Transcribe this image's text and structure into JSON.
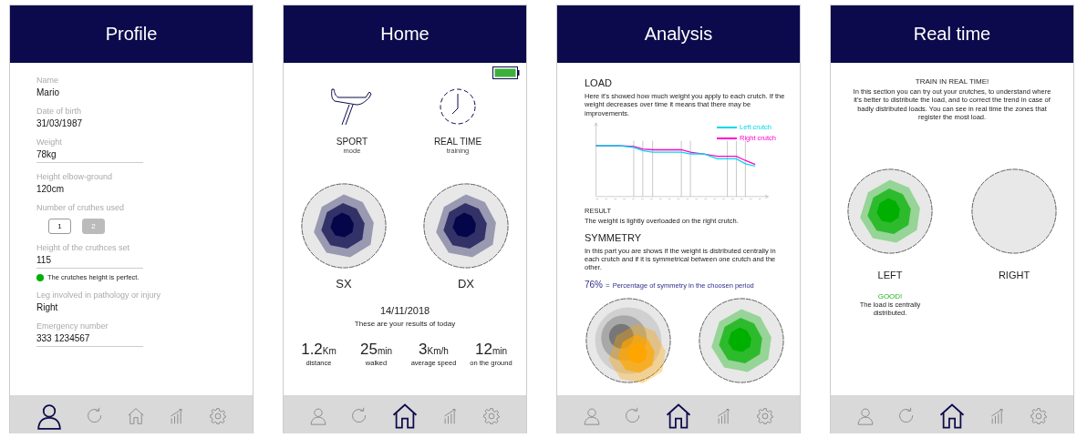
{
  "screens": [
    {
      "kind": "profile",
      "title": "Profile",
      "fields": [
        {
          "kind": "text",
          "label": "Name",
          "value": "Mario"
        },
        {
          "kind": "text",
          "label": "Date of birth",
          "value": "31/03/1987"
        },
        {
          "kind": "input",
          "label": "Weight",
          "value": "78kg"
        },
        {
          "kind": "text",
          "label": "Height elbow-ground",
          "value": "120cm"
        },
        {
          "kind": "choice",
          "label": "Number of cruthes used",
          "options": [
            {
              "label": "1",
              "selected": true
            },
            {
              "label": "2",
              "selected": false
            }
          ]
        },
        {
          "kind": "input",
          "label": "Height of the cruthces set",
          "value": "115",
          "note": {
            "text": "The crutches height is perfect.",
            "color": "#00b000"
          }
        },
        {
          "kind": "text",
          "label": "Leg involved in pathology or injury",
          "value": "Right"
        },
        {
          "kind": "input",
          "label": "Emergency number",
          "value": "333 1234567"
        }
      ],
      "nav": [
        {
          "kind": "profile",
          "selected": true
        },
        {
          "kind": "history",
          "selected": false
        },
        {
          "kind": "home",
          "selected": false
        },
        {
          "kind": "analysis",
          "selected": false
        },
        {
          "kind": "settings",
          "selected": false
        }
      ]
    },
    {
      "kind": "home",
      "title": "Home",
      "modes": [
        {
          "kind": "crutch",
          "title": "SPORT",
          "subtitle": "mode"
        },
        {
          "kind": "clock",
          "title": "REAL TIME",
          "subtitle": "training"
        }
      ],
      "maps": [
        {
          "label": "SX",
          "kind": "centered",
          "color": "#05054a"
        },
        {
          "label": "DX",
          "kind": "centered",
          "color": "#05054a"
        }
      ],
      "date": "14/11/2018",
      "caption": "These are your results of today",
      "stats": [
        {
          "value": "1.2",
          "unit": "Km",
          "label": "distance"
        },
        {
          "value": "25",
          "unit": "min",
          "label": "walked"
        },
        {
          "value": "3",
          "unit": "Km/h",
          "label": "average speed"
        },
        {
          "value": "12",
          "unit": "min",
          "label": "on the ground"
        }
      ],
      "nav": [
        {
          "kind": "profile",
          "selected": false
        },
        {
          "kind": "history",
          "selected": false
        },
        {
          "kind": "home",
          "selected": true
        },
        {
          "kind": "analysis",
          "selected": false
        },
        {
          "kind": "settings",
          "selected": false
        }
      ]
    },
    {
      "kind": "analysis",
      "title": "Analysis",
      "load_heading": "LOAD",
      "load_text": "Here it's showed how much weight you apply to each crutch. If the weight decreases over time it means that there may be improvements.",
      "legend": [
        {
          "label": "Left crutch",
          "color": "#00d8e8"
        },
        {
          "label": "Right crutch",
          "color": "#ff00d0"
        }
      ],
      "result_heading": "RESULT",
      "result_text": "The weight is lightly overloaded on the right crutch.",
      "symmetry_heading": "SYMMETRY",
      "symmetry_text": "In this part you are shows if the weight is distributed centrally in each crutch and if it is symmetrical between one crutch and the other.",
      "symmetry_value": "76%",
      "symmetry_sign": "=",
      "symmetry_caption": "Percentage of symmetry in the choosen period",
      "maps": [
        {
          "kind": "offset",
          "color": "#ffa500"
        },
        {
          "kind": "centered",
          "color": "#00b000"
        }
      ],
      "nav": [
        {
          "kind": "profile",
          "selected": false
        },
        {
          "kind": "history",
          "selected": false
        },
        {
          "kind": "home",
          "selected": true
        },
        {
          "kind": "analysis",
          "selected": false
        },
        {
          "kind": "settings",
          "selected": false
        }
      ]
    },
    {
      "kind": "realtime",
      "title": "Real time",
      "heading": "TRAIN IN REAL TIME!",
      "text": "In this section you can try out your crutches, to understand where it's better to distribute the load, and to correct the trend in case of badly distributed loads. You can see in real time the zones that register the most load.",
      "maps": [
        {
          "label": "LEFT",
          "kind": "centered",
          "color": "#00b000",
          "verdict": "GOOD!",
          "verdict_text": "The load is centrally distributed."
        },
        {
          "label": "RIGHT",
          "kind": "empty"
        }
      ],
      "nav": [
        {
          "kind": "profile",
          "selected": false
        },
        {
          "kind": "history",
          "selected": false
        },
        {
          "kind": "home",
          "selected": true
        },
        {
          "kind": "analysis",
          "selected": false
        },
        {
          "kind": "settings",
          "selected": false
        }
      ]
    }
  ]
}
